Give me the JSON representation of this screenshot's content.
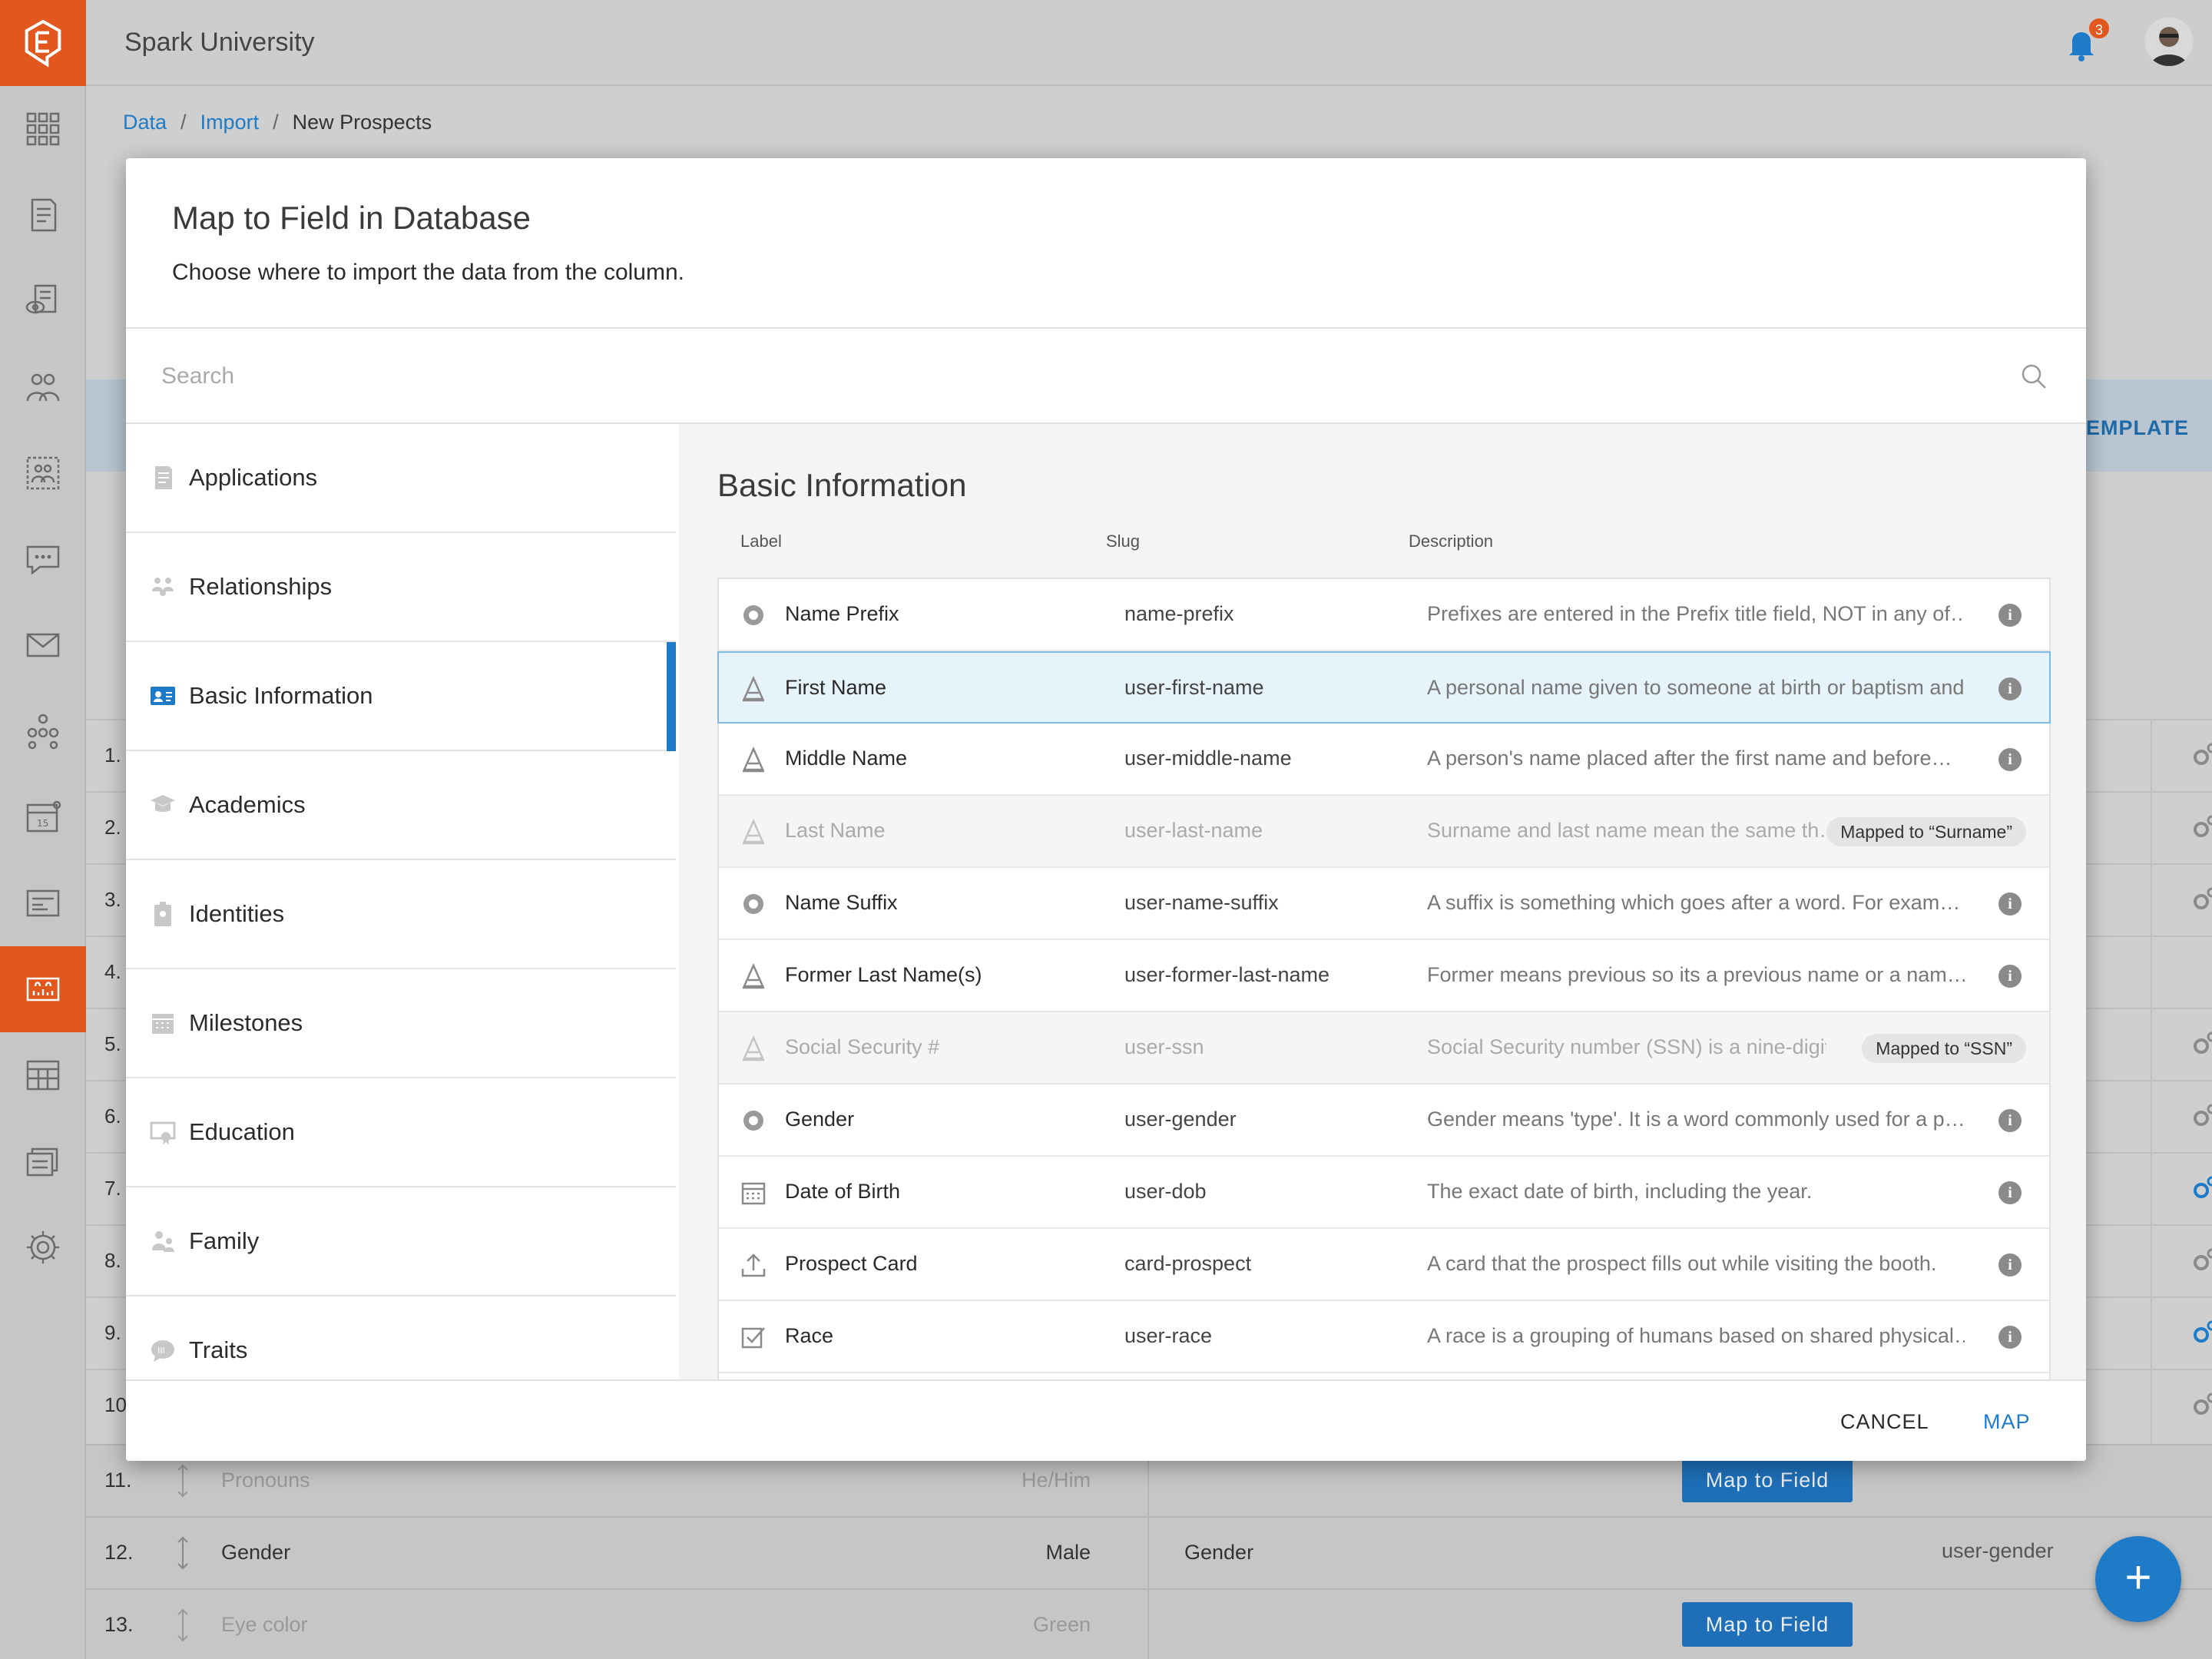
{
  "app": {
    "org_name": "Spark University",
    "notification_count": "3"
  },
  "breadcrumb": [
    "Data",
    "Import",
    "New Prospects"
  ],
  "background": {
    "banner_action": "EMPLATE",
    "row_numbers": [
      "1.",
      "2.",
      "3.",
      "4.",
      "5.",
      "6.",
      "7.",
      "8.",
      "9.",
      "10."
    ],
    "rows": [
      {
        "num": "11.",
        "field": "Pronouns",
        "value": "He/Him",
        "action": "Map to Field",
        "mapped_label": "",
        "mapped_slug": "",
        "muted": true
      },
      {
        "num": "12.",
        "field": "Gender",
        "value": "Male",
        "action": "",
        "mapped_label": "Gender",
        "mapped_slug": "user-gender",
        "muted": false
      },
      {
        "num": "13.",
        "field": "Eye color",
        "value": "Green",
        "action": "Map to Field",
        "mapped_label": "",
        "mapped_slug": "",
        "muted": true
      }
    ]
  },
  "modal": {
    "title": "Map to Field in Database",
    "subtitle": "Choose where to import the data from the column.",
    "search_placeholder": "Search",
    "categories": [
      {
        "label": "Applications",
        "icon": "document-icon"
      },
      {
        "label": "Relationships",
        "icon": "people-icon"
      },
      {
        "label": "Basic Information",
        "icon": "id-card-icon",
        "active": true
      },
      {
        "label": "Academics",
        "icon": "graduation-icon"
      },
      {
        "label": "Identities",
        "icon": "badge-icon"
      },
      {
        "label": "Milestones",
        "icon": "calendar-icon"
      },
      {
        "label": "Education",
        "icon": "certificate-icon"
      },
      {
        "label": "Family",
        "icon": "family-icon"
      },
      {
        "label": "Traits",
        "icon": "chat-icon"
      }
    ],
    "section_title": "Basic Information",
    "columns": {
      "label": "Label",
      "slug": "Slug",
      "description": "Description"
    },
    "fields": [
      {
        "label": "Name Prefix",
        "slug": "name-prefix",
        "description": "Prefixes are entered in the Prefix title field, NOT in any of…",
        "icon": "radio-icon"
      },
      {
        "label": "First Name",
        "slug": "user-first-name",
        "description": "A personal name given to someone at birth or baptism and…",
        "icon": "text-icon",
        "selected": true
      },
      {
        "label": "Middle Name",
        "slug": "user-middle-name",
        "description": "A person's name placed after the first name and before…",
        "icon": "text-icon"
      },
      {
        "label": "Last Name",
        "slug": "user-last-name",
        "description": "Surname and last name mean the same th…",
        "icon": "text-icon",
        "mapped": "Mapped to “Surname”"
      },
      {
        "label": "Name Suffix",
        "slug": "user-name-suffix",
        "description": "A suffix is something which goes after a word. For exam…",
        "icon": "radio-icon"
      },
      {
        "label": "Former Last Name(s)",
        "slug": "user-former-last-name",
        "description": "Former means previous so its a previous name or a nam…",
        "icon": "text-icon"
      },
      {
        "label": "Social Security #",
        "slug": "user-ssn",
        "description": "Social Security number (SSN) is a nine-digit n…",
        "icon": "text-icon",
        "mapped": "Mapped to “SSN”"
      },
      {
        "label": "Gender",
        "slug": "user-gender",
        "description": "Gender means 'type'. It is a word commonly used for a p…",
        "icon": "radio-icon"
      },
      {
        "label": "Date of Birth",
        "slug": "user-dob",
        "description": "The exact date of birth, including the year.",
        "icon": "calendar-icon"
      },
      {
        "label": "Prospect Card",
        "slug": "card-prospect",
        "description": "A card that the prospect fills out while visiting the booth.",
        "icon": "upload-icon"
      },
      {
        "label": "Race",
        "slug": "user-race",
        "description": "A race is a grouping of humans based on shared physical…",
        "icon": "checkbox-icon"
      }
    ],
    "cancel_label": "CANCEL",
    "map_label": "MAP"
  },
  "colors": {
    "brand": "#e2571e",
    "accent": "#1e7bc8"
  }
}
